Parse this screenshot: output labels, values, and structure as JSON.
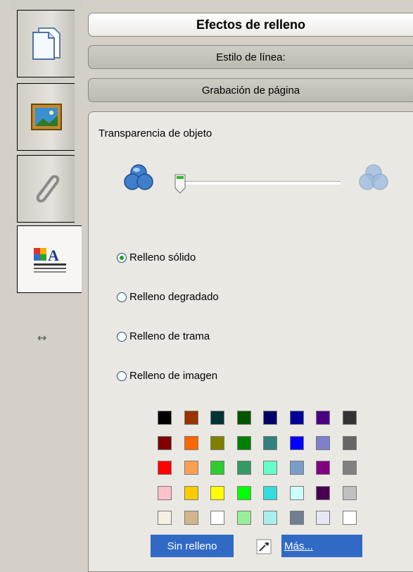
{
  "tabs": [
    {
      "icon": "page-icon"
    },
    {
      "icon": "picture-icon"
    },
    {
      "icon": "paperclip-icon"
    },
    {
      "icon": "fill-effects-icon",
      "active": true
    }
  ],
  "resize_icon": "horizontal-resize-icon",
  "sections": {
    "main_title": "Efectos de relleno",
    "line_style": "Estilo de línea:",
    "page_recording": "Grabación de página"
  },
  "transparency": {
    "label": "Transparencia de objeto",
    "value": 0.0
  },
  "fill_options": [
    {
      "label": "Relleno sólido",
      "checked": true
    },
    {
      "label": "Relleno degradado",
      "checked": false
    },
    {
      "label": "Relleno de trama",
      "checked": false
    },
    {
      "label": "Relleno de imagen",
      "checked": false
    }
  ],
  "palette": [
    [
      "#000000",
      "#993300",
      "#003333",
      "#005500",
      "#000066",
      "#000099",
      "#4b0082",
      "#333333"
    ],
    [
      "#800000",
      "#ff6600",
      "#808000",
      "#008000",
      "#338080",
      "#0000ff",
      "#7f7fcc",
      "#666666"
    ],
    [
      "#ff0000",
      "#ffa050",
      "#2ecc2e",
      "#339966",
      "#66ffcc",
      "#7a9cc8",
      "#800080",
      "#808080"
    ],
    [
      "#ffc0cb",
      "#ffcc00",
      "#ffff00",
      "#00ff00",
      "#33dddd",
      "#ccffff",
      "#4a0050",
      "#c0c0c0"
    ],
    [
      "#f5efe4",
      "#d2b48c",
      "#ffffff",
      "#99ee99",
      "#aaeeee",
      "#708090",
      "#e6e6f5",
      "#ffffff"
    ]
  ],
  "no_fill_label": "Sin relleno",
  "more_label": "Más...",
  "accent": "#316ac5"
}
